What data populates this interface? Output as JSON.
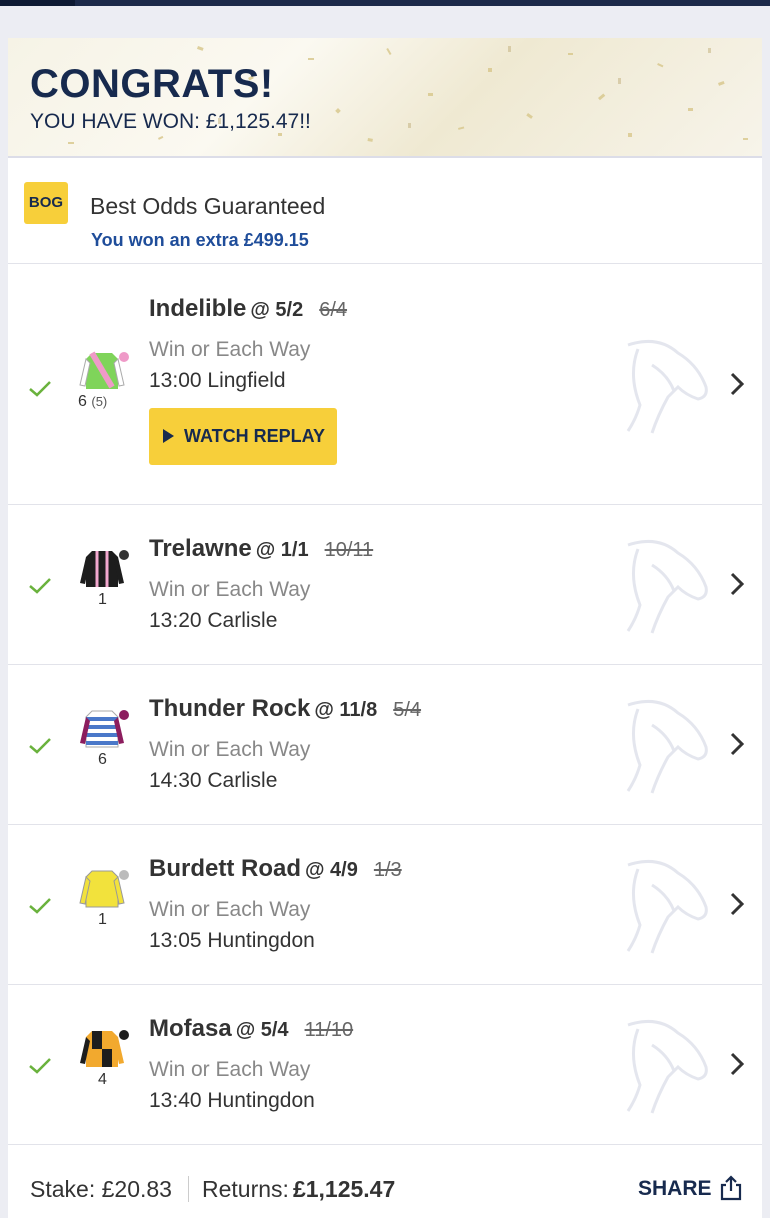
{
  "banner": {
    "title": "CONGRATS!",
    "subtitle": "YOU HAVE WON: £1,125.47!!"
  },
  "bog": {
    "badge": "BOG",
    "title": "Best Odds Guaranteed",
    "extra": "You won an extra £499.15"
  },
  "selections": [
    {
      "name": "Indelible",
      "odds": "@ 5/2",
      "old_odds": "6/4",
      "market": "Win or Each Way",
      "race": "13:00 Lingfield",
      "cloth": "6",
      "draw": "(5)",
      "replay_label": "WATCH REPLAY"
    },
    {
      "name": "Trelawne",
      "odds": "@ 1/1",
      "old_odds": "10/11",
      "market": "Win or Each Way",
      "race": "13:20 Carlisle",
      "cloth": "1"
    },
    {
      "name": "Thunder Rock",
      "odds": "@ 11/8",
      "old_odds": "5/4",
      "market": "Win or Each Way",
      "race": "14:30 Carlisle",
      "cloth": "6"
    },
    {
      "name": "Burdett Road",
      "odds": "@ 4/9",
      "old_odds": "1/3",
      "market": "Win or Each Way",
      "race": "13:05 Huntingdon",
      "cloth": "1"
    },
    {
      "name": "Mofasa",
      "odds": "@ 5/4",
      "old_odds": "11/10",
      "market": "Win or Each Way",
      "race": "13:40 Huntingdon",
      "cloth": "4"
    }
  ],
  "footer": {
    "stake_label": "Stake:",
    "stake_value": "£20.83",
    "returns_label": "Returns:",
    "returns_value": "£1,125.47",
    "share_label": "SHARE"
  },
  "colors": {
    "navy": "#172a4e",
    "accent_yellow": "#f7cf3a",
    "win_green": "#6ab23d",
    "link_blue": "#1f4d9a"
  },
  "icons": {
    "check": "check-icon",
    "chevron": "chevron-right-icon",
    "share": "share-icon",
    "horse": "horse-head-icon"
  }
}
